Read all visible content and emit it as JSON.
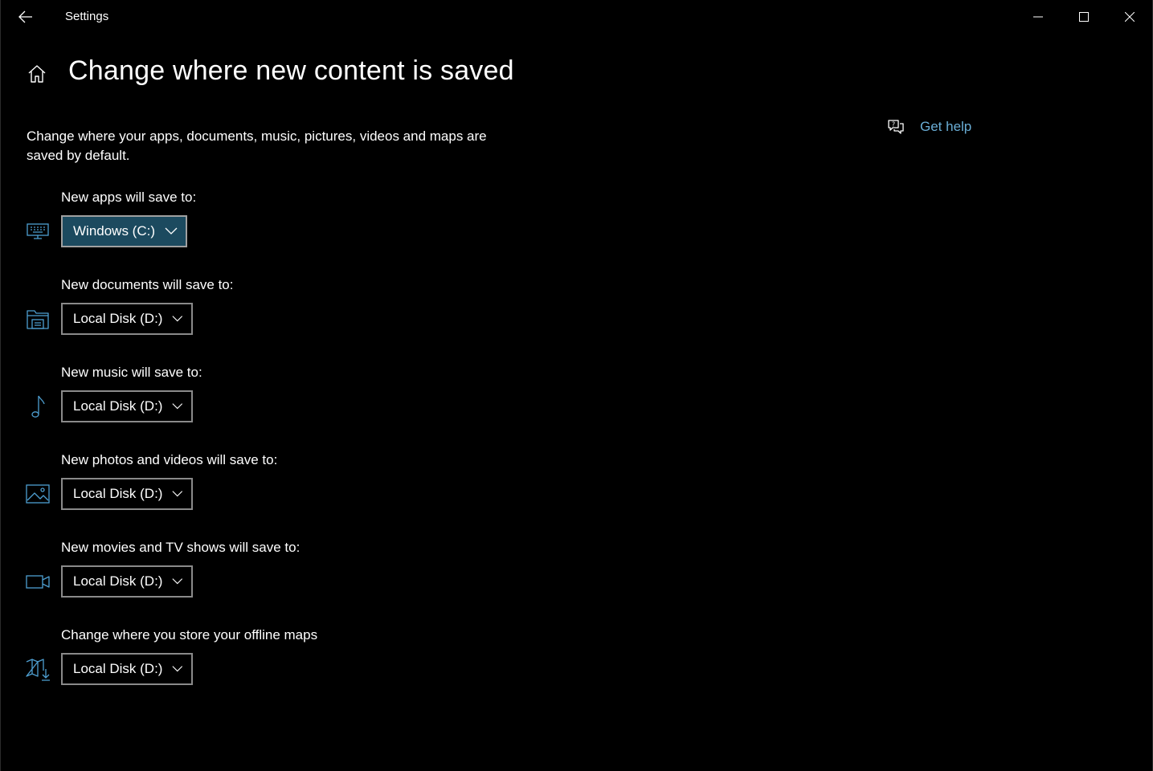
{
  "window": {
    "title": "Settings"
  },
  "header": {
    "title": "Change where new content is saved",
    "description": "Change where your apps, documents, music, pictures, videos and maps are saved by default."
  },
  "help": {
    "label": "Get help",
    "icon": "chat-help-icon"
  },
  "colors": {
    "accent": "#6aaed6",
    "selected_dropdown_bg": "#1c4a5f",
    "icon_color": "#4e9fd1"
  },
  "settings": [
    {
      "label": "New apps will save to:",
      "value": "Windows (C:)",
      "icon": "keyboard-icon"
    },
    {
      "label": "New documents will save to:",
      "value": "Local Disk (D:)",
      "icon": "documents-folder-icon"
    },
    {
      "label": "New music will save to:",
      "value": "Local Disk (D:)",
      "icon": "music-note-icon"
    },
    {
      "label": "New photos and videos will save to:",
      "value": "Local Disk (D:)",
      "icon": "picture-icon"
    },
    {
      "label": "New movies and TV shows will save to:",
      "value": "Local Disk (D:)",
      "icon": "video-camera-icon"
    },
    {
      "label": "Change where you store your offline maps",
      "value": "Local Disk (D:)",
      "icon": "map-download-icon"
    }
  ]
}
